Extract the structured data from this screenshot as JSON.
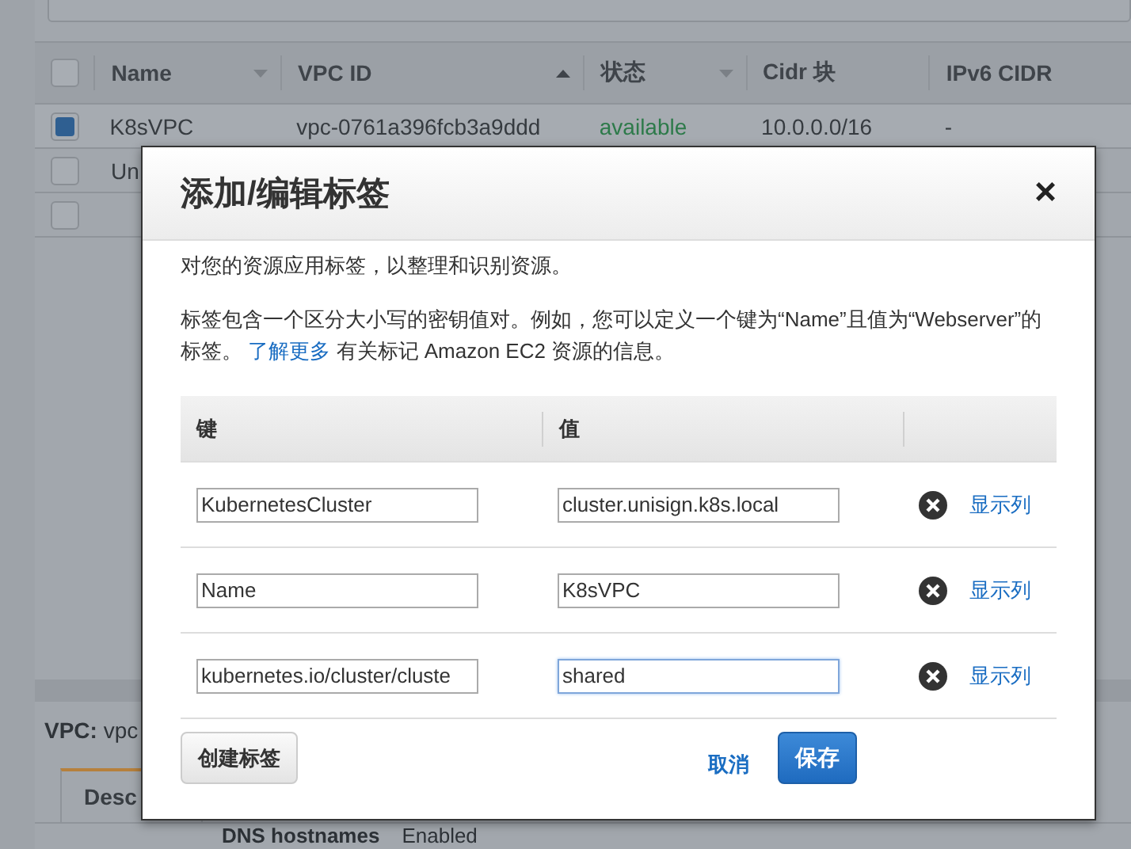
{
  "table": {
    "all_checked": false,
    "columns": [
      {
        "label": "Name",
        "kind": "menu"
      },
      {
        "label": "VPC ID",
        "kind": "sorted"
      },
      {
        "label": "状态",
        "kind": "menu"
      },
      {
        "label": "Cidr 块",
        "kind": "plain"
      },
      {
        "label": "IPv6 CIDR",
        "kind": "plain"
      }
    ],
    "rows": [
      {
        "checked": true,
        "cells": [
          "K8sVPC",
          "vpc-0761a396fcb3a9ddd",
          "available",
          "10.0.0.0/16",
          "-"
        ]
      },
      {
        "checked": false,
        "cells": [
          "Un"
        ]
      },
      {
        "checked": false,
        "cells": []
      }
    ]
  },
  "details": {
    "label": "VPC:",
    "value": "vpc",
    "tab": "Desc",
    "field": "DNS hostnames",
    "field_value": "Enabled"
  },
  "dialog": {
    "title": "添加/编辑标签",
    "close": "×",
    "intro": "对您的资源应用标签，以整理和识别资源。",
    "description": {
      "before": "标签包含一个区分大小写的密钥值对。例如，您可以定义一个键为“Name”且值为“Webserver”的标签。",
      "link": "了解更多",
      "after": "有关标记 Amazon EC2 资源的信息。"
    },
    "columns": [
      "键",
      "值"
    ],
    "tags": [
      {
        "key": "KubernetesCluster",
        "value": "cluster.unisign.k8s.local",
        "focused": false,
        "action": "显示列"
      },
      {
        "key": "Name",
        "value": "K8sVPC",
        "focused": false,
        "action": "显示列"
      },
      {
        "key": "kubernetes.io/cluster/cluste",
        "value": "shared",
        "focused": true,
        "action": "显示列"
      }
    ],
    "create_button": "创建标签",
    "cancel": "取消",
    "save": "保存"
  }
}
